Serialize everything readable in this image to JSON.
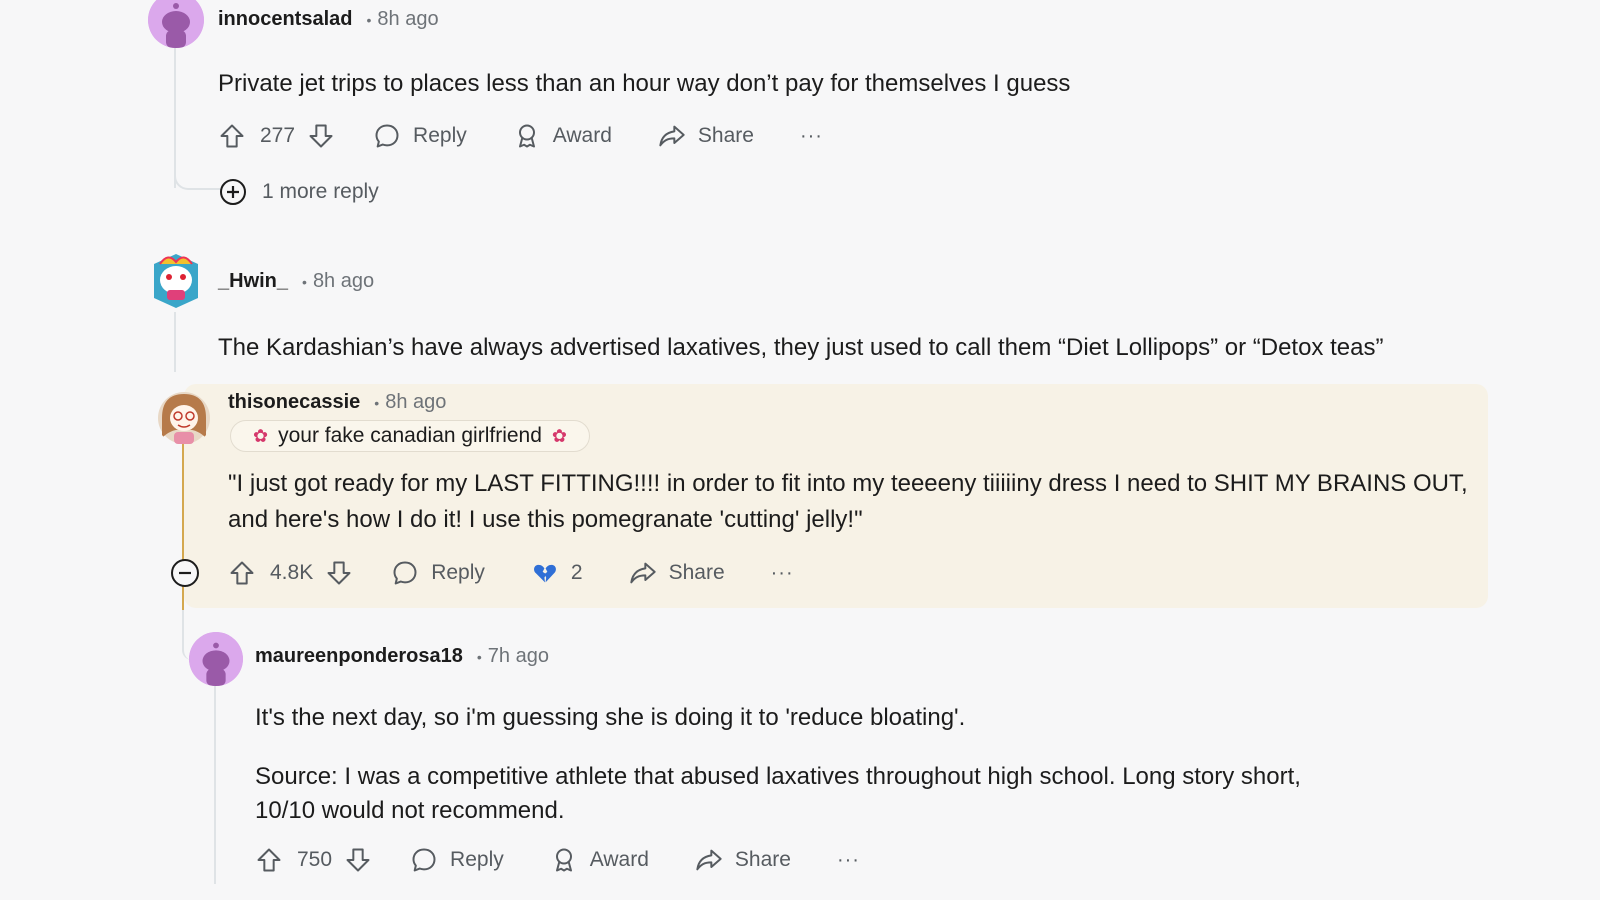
{
  "colors": {
    "background": "#f7f7f8",
    "highlight_bg": "#f7f2e6",
    "highlight_rail": "#d4a84f",
    "avatar_purple": "#c66ee0",
    "flair_leaf": "#d5386b",
    "award_blue": "#2f6fd6"
  },
  "comments": [
    {
      "username": "innocentsalad",
      "time": "8h ago",
      "body": "Private jet trips to places less than an hour way don’t pay for themselves I guess",
      "votes": "277",
      "reply_label": "Reply",
      "award_label": "Award",
      "share_label": "Share",
      "more_replies": "1 more reply"
    },
    {
      "username": "_Hwin_",
      "time": "8h ago",
      "body": "The Kardashian’s have always advertised laxatives, they just used to call them “Diet Lollipops” or “Detox teas”"
    },
    {
      "username": "thisonecassie",
      "time": "8h ago",
      "flair": "your fake canadian girlfriend",
      "flair_icon": "maple-leaf-icon",
      "body": "\"I just got ready for my LAST FITTING!!!! in order to fit into my teeeeny tiiiiiny dress I need to SHIT MY BRAINS OUT, and here's how I do it! I use this pomegranate 'cutting' jelly!\"",
      "votes": "4.8K",
      "reply_label": "Reply",
      "award_count": "2",
      "award_icon": "broken-heart-icon",
      "share_label": "Share"
    },
    {
      "username": "maureenponderosa18",
      "time": "7h ago",
      "body_1": "It's the next day, so i'm guessing she is doing it to 'reduce bloating'.",
      "body_2": "Source: I was a competitive athlete that abused laxatives throughout high school. Long story short, 10/10 would not recommend.",
      "votes": "750",
      "reply_label": "Reply",
      "award_label": "Award",
      "share_label": "Share"
    }
  ],
  "more_label": "···"
}
